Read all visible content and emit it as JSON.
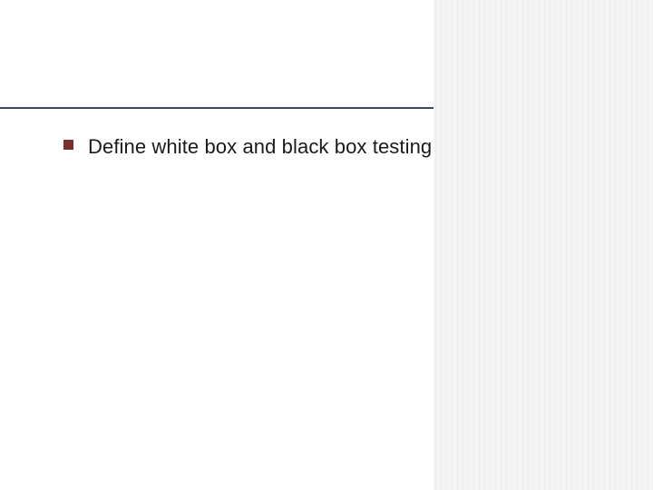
{
  "slide": {
    "bullets": [
      {
        "text": "Define white box and black box testing"
      }
    ]
  },
  "colors": {
    "accent_line": "#3a4a63",
    "bullet_marker": "#7a2f2f",
    "stripes_light": "#f4f4f4",
    "stripes_dark": "#ececec"
  }
}
